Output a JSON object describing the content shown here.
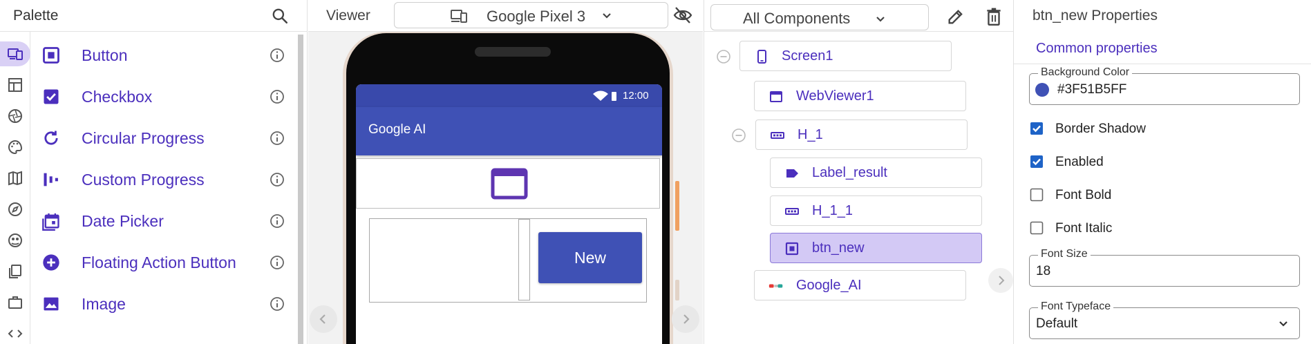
{
  "palette": {
    "title": "Palette",
    "categories": [
      "user-interface",
      "layout",
      "media",
      "drawing-animation",
      "maps",
      "sensors",
      "social",
      "storage",
      "connectivity",
      "extensions"
    ],
    "items": [
      {
        "label": "Button",
        "icon": "button-icon"
      },
      {
        "label": "Checkbox",
        "icon": "checkbox-icon"
      },
      {
        "label": "Circular Progress",
        "icon": "circular-progress-icon"
      },
      {
        "label": "Custom Progress",
        "icon": "custom-progress-icon"
      },
      {
        "label": "Date Picker",
        "icon": "date-picker-icon"
      },
      {
        "label": "Floating Action Button",
        "icon": "fab-icon"
      },
      {
        "label": "Image",
        "icon": "image-icon"
      }
    ]
  },
  "viewer": {
    "title": "Viewer",
    "device": "Google Pixel 3",
    "status_time": "12:00",
    "app_title": "Google AI",
    "new_button_label": "New"
  },
  "components": {
    "filter": "All Components",
    "tree": [
      {
        "label": "Screen1",
        "icon": "phone-icon"
      },
      {
        "label": "WebViewer1",
        "icon": "webviewer-icon"
      },
      {
        "label": "H_1",
        "icon": "horizontal-arrangement-icon"
      },
      {
        "label": "Label_result",
        "icon": "label-icon"
      },
      {
        "label": "H_1_1",
        "icon": "horizontal-arrangement-icon"
      },
      {
        "label": "btn_new",
        "icon": "button-icon"
      },
      {
        "label": "Google_AI",
        "icon": "ai-extension-icon"
      }
    ]
  },
  "properties": {
    "title": "btn_new Properties",
    "section": "Common properties",
    "background_color_label": "Background Color",
    "background_color_value": "#3F51B5FF",
    "border_shadow_label": "Border Shadow",
    "enabled_label": "Enabled",
    "font_bold_label": "Font Bold",
    "font_italic_label": "Font Italic",
    "font_size_label": "Font Size",
    "font_size_value": "18",
    "font_typeface_label": "Font Typeface",
    "font_typeface_value": "Default",
    "border_shadow_checked": true,
    "enabled_checked": true,
    "font_bold_checked": false,
    "font_italic_checked": false
  },
  "colors": {
    "accent": "#4b2fbd",
    "selected_bg": "#d3c9f5",
    "app_primary": "#3f51b5",
    "status_bar": "#3949ab"
  }
}
